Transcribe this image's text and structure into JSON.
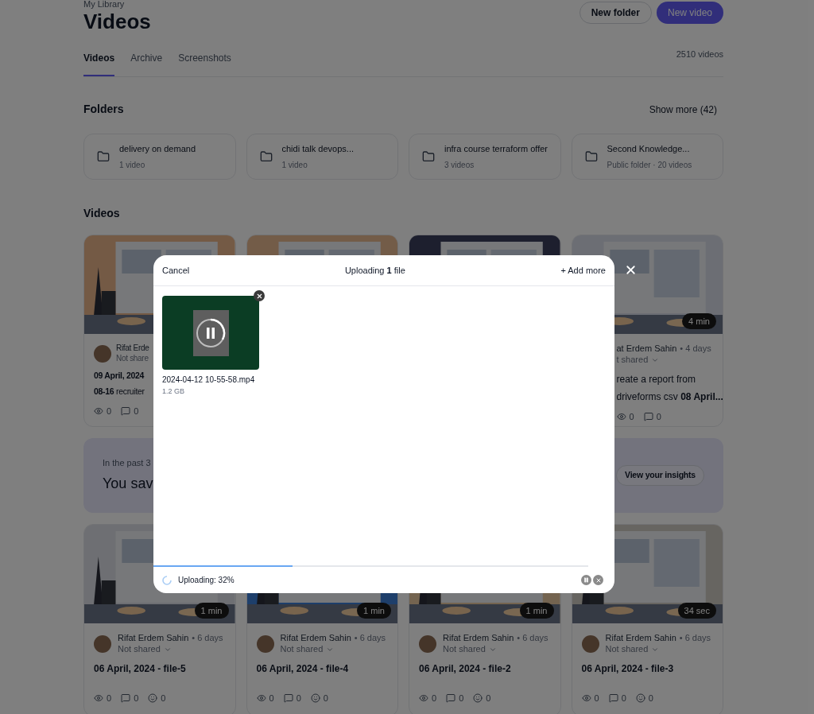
{
  "header": {
    "breadcrumb": "My Library",
    "title": "Videos",
    "buttons": [
      {
        "label": "New folder",
        "kind": "secondary"
      },
      {
        "label": "New video",
        "kind": "primary"
      }
    ]
  },
  "tabs": [
    {
      "label": "Videos",
      "selected": true
    },
    {
      "label": "Archive",
      "selected": false
    },
    {
      "label": "Screenshots",
      "selected": false
    }
  ],
  "video_count": "2510 videos",
  "folders": {
    "title": "Folders",
    "show_more": "Show more (42)",
    "items": [
      {
        "name": "delivery on demand",
        "meta": "1 video"
      },
      {
        "name": "chidi talk devops...",
        "meta": "1 video"
      },
      {
        "name": "infra course terraform offer",
        "meta": "3 videos"
      },
      {
        "name": "Second Knowledge...",
        "meta": "Public folder · 20 videos"
      }
    ]
  },
  "videos_title": "Videos",
  "first_row": [
    {
      "kind": "left_part",
      "author": "Rifat Erde",
      "sharing": "Not share",
      "title_lines": [
        "**09 April, 2024**",
        "**08-16** recruiter"
      ],
      "stats": [
        "0",
        "0"
      ]
    },
    {
      "kind": "thumbnail_only"
    },
    {
      "kind": "thumbnail_only"
    },
    {
      "kind": "right_part",
      "duration": "4 min",
      "author": "at Erdem Sahin",
      "age": "• 4 days",
      "sharing": "t shared",
      "title_lines": [
        "reate a report from",
        "driveforms csv **08 April...**"
      ],
      "stats": [
        "0",
        "0"
      ]
    }
  ],
  "insights": {
    "caption": "In the past 3",
    "headline": "You sav",
    "button": "View your insights"
  },
  "second_row": [
    {
      "kind": "full",
      "duration": "1 min",
      "author": "Rifat Erdem Sahin",
      "age": "• 6 days",
      "sharing": "Not shared",
      "title": "06 April, 2024 - file-5",
      "stats": [
        "0",
        "0",
        "0"
      ]
    },
    {
      "kind": "full",
      "duration": "1 min",
      "author": "Rifat Erdem Sahin",
      "age": "• 6 days",
      "sharing": "Not shared",
      "title": "06 April, 2024 - file-4",
      "stats": [
        "0",
        "0",
        "0"
      ]
    },
    {
      "kind": "full",
      "duration": "1 min",
      "author": "Rifat Erdem Sahin",
      "age": "• 6 days",
      "sharing": "Not shared",
      "title": "06 April, 2024 - file-2",
      "stats": [
        "0",
        "0",
        "0"
      ]
    },
    {
      "kind": "full",
      "duration": "34 sec",
      "author": "Rifat Erdem Sahin",
      "age": "• 6 days",
      "sharing": "Not shared",
      "title": "06 April, 2024 - file-3",
      "stats": [
        "0",
        "0",
        "0"
      ]
    }
  ],
  "upload_dialog": {
    "cancel": "Cancel",
    "title": "Uploading **1** file",
    "add_more": "+ Add more",
    "files": [
      {
        "name": "2024-04-12 10-55-58.mp4",
        "size": "1.2 GB"
      }
    ],
    "progress": {
      "level": 0.32,
      "status": "Uploading: 32%"
    }
  }
}
